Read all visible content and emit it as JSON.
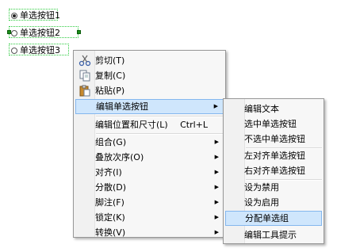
{
  "radios": [
    {
      "label": "单选按钮1",
      "checked": true
    },
    {
      "label": "单选按钮2",
      "checked": false
    },
    {
      "label": "单选按钮3",
      "checked": false
    }
  ],
  "context_menu": {
    "cut": "剪切(T)",
    "copy": "复制(C)",
    "paste": "粘贴(P)",
    "edit_radio": "编辑单选按钮",
    "edit_pos_size": "编辑位置和尺寸(L)",
    "edit_pos_size_shortcut": "Ctrl+L",
    "group": "组合(G)",
    "order": "叠放次序(O)",
    "align": "对齐(I)",
    "distribute": "分散(D)",
    "footnote": "脚注(F)",
    "lock": "锁定(K)",
    "convert": "转换(V)"
  },
  "submenu": {
    "edit_text": "编辑文本",
    "select_radio": "选中单选按钮",
    "unselect_radio": "不选中单选按钮",
    "align_left": "左对齐单选按钮",
    "align_right": "右对齐单选按钮",
    "set_disabled": "设为禁用",
    "set_enabled": "设为启用",
    "assign_group": "分配单选组",
    "edit_tooltip": "编辑工具提示"
  }
}
